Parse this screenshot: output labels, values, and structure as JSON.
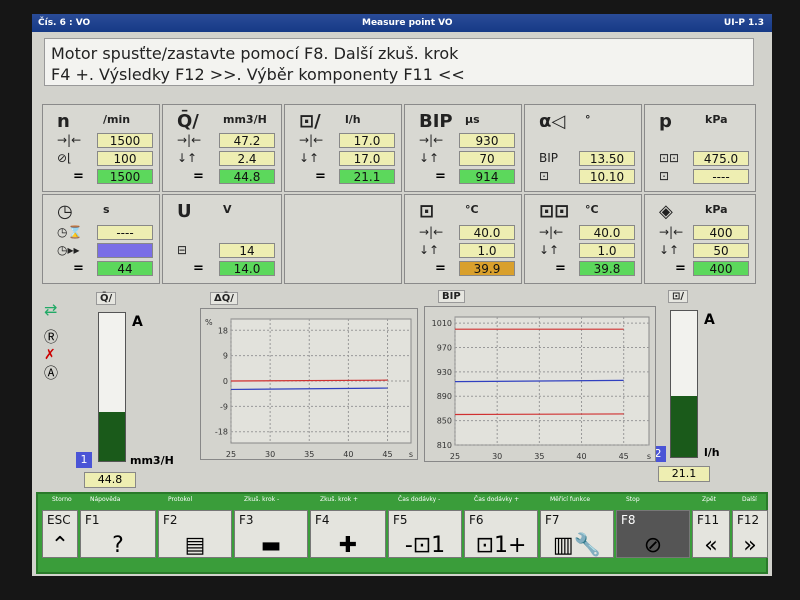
{
  "titlebar": {
    "left": "Čís. 6 : VO",
    "center": "Measure point VO",
    "right": "UI-P 1.3"
  },
  "message": {
    "line1": "Motor spusťte/zastavte pomocí F8. Další zkuš. krok",
    "line2": "F4 +. Výsledky F12 >>. Výběr komponenty F11 <<"
  },
  "panels": [
    {
      "title": "n",
      "unit": "/min",
      "rows": [
        {
          "icon": "→|←",
          "value": "1500",
          "color": "yellow"
        },
        {
          "icon": "⊘⌊",
          "value": "100",
          "color": "yellow"
        },
        {
          "icon": "=",
          "value": "1500",
          "color": "green"
        }
      ]
    },
    {
      "title": "Q̄/",
      "unit": "mm3/H",
      "rows": [
        {
          "icon": "→|←",
          "value": "47.2",
          "color": "yellow"
        },
        {
          "icon": "↓↑",
          "value": "2.4",
          "color": "yellow"
        },
        {
          "icon": "=",
          "value": "44.8",
          "color": "green"
        }
      ]
    },
    {
      "title": "⊡/",
      "unit": "l/h",
      "rows": [
        {
          "icon": "→|←",
          "value": "17.0",
          "color": "yellow"
        },
        {
          "icon": "↓↑",
          "value": "17.0",
          "color": "yellow"
        },
        {
          "icon": "=",
          "value": "21.1",
          "color": "green"
        }
      ]
    },
    {
      "title": "BIP",
      "unit": "µs",
      "rows": [
        {
          "icon": "→|←",
          "value": "930",
          "color": "yellow"
        },
        {
          "icon": "↓↑",
          "value": "70",
          "color": "yellow"
        },
        {
          "icon": "=",
          "value": "914",
          "color": "green"
        }
      ]
    },
    {
      "title": "α◁",
      "unit": "°",
      "rows": [
        {
          "icon": "BIP",
          "value": "13.50",
          "color": "yellow"
        },
        {
          "icon": "⊡",
          "value": "10.10",
          "color": "yellow"
        }
      ]
    },
    {
      "title": "p",
      "unit": "kPa",
      "rows": [
        {
          "icon": "⊡⊡",
          "value": "475.0",
          "color": "yellow"
        },
        {
          "icon": "⊡",
          "value": "----",
          "color": "yellow"
        }
      ]
    },
    {
      "title": "◷",
      "unit": "s",
      "rows": [
        {
          "icon": "◷⌛",
          "value": "----",
          "color": "yellow"
        },
        {
          "icon": "◷▸▸",
          "value": "",
          "color": "blue"
        },
        {
          "icon": "=",
          "value": "44",
          "color": "green"
        }
      ]
    },
    {
      "title": "U",
      "unit": "V",
      "rows": [
        {
          "icon": "⊟",
          "value": "14",
          "color": "yellow"
        },
        {
          "icon": "=",
          "value": "14.0",
          "color": "green"
        }
      ]
    },
    {
      "title": "",
      "unit": "",
      "rows": []
    },
    {
      "title": "⊡",
      "unit": "°C",
      "rows": [
        {
          "icon": "→|←",
          "value": "40.0",
          "color": "yellow"
        },
        {
          "icon": "↓↑",
          "value": "1.0",
          "color": "yellow"
        },
        {
          "icon": "=",
          "value": "39.9",
          "color": "orange"
        }
      ]
    },
    {
      "title": "⊡⊡",
      "unit": "°C",
      "rows": [
        {
          "icon": "→|←",
          "value": "40.0",
          "color": "yellow"
        },
        {
          "icon": "↓↑",
          "value": "1.0",
          "color": "yellow"
        },
        {
          "icon": "=",
          "value": "39.8",
          "color": "green"
        }
      ]
    },
    {
      "title": "◈",
      "unit": "kPa",
      "rows": [
        {
          "icon": "→|←",
          "value": "400",
          "color": "yellow"
        },
        {
          "icon": "↓↑",
          "value": "50",
          "color": "yellow"
        },
        {
          "icon": "=",
          "value": "400",
          "color": "green"
        }
      ]
    }
  ],
  "left_bar": {
    "label": "Q̄/",
    "letter": "A",
    "unit": "mm3/H",
    "badge": "1",
    "value": "44.8",
    "fill": 0.33
  },
  "right_bar": {
    "label": "⊡/",
    "letter": "A",
    "unit": "l/h",
    "badge": "2",
    "value": "21.1",
    "fill": 0.42
  },
  "chart_data": [
    {
      "type": "line",
      "title": "ΔQ̄/",
      "ylabel": "%",
      "x_ticks": [
        "25",
        "30",
        "35",
        "40",
        "45",
        "s"
      ],
      "y_ticks": [
        "18",
        "9",
        "0",
        "-9",
        "-18"
      ],
      "xlim": [
        25,
        48
      ],
      "ylim": [
        -22,
        22
      ],
      "series": [
        {
          "color": "#d03030",
          "x": [
            25,
            45
          ],
          "y": [
            0,
            0.3
          ]
        },
        {
          "color": "#3040c0",
          "x": [
            25,
            45
          ],
          "y": [
            -3,
            -2.5
          ]
        }
      ]
    },
    {
      "type": "line",
      "title": "BIP",
      "ylabel": "",
      "x_ticks": [
        "25",
        "30",
        "35",
        "40",
        "45",
        "s"
      ],
      "y_ticks": [
        "1010",
        "970",
        "930",
        "890",
        "850",
        "810"
      ],
      "xlim": [
        25,
        48
      ],
      "ylim": [
        810,
        1020
      ],
      "series": [
        {
          "color": "#d03030",
          "x": [
            25,
            45
          ],
          "y": [
            1000,
            1000
          ]
        },
        {
          "color": "#3040c0",
          "x": [
            25,
            45
          ],
          "y": [
            914,
            916
          ]
        },
        {
          "color": "#d03030",
          "x": [
            25,
            45
          ],
          "y": [
            860,
            861
          ]
        }
      ]
    }
  ],
  "fkeys": {
    "top_labels": [
      "Storno",
      "Nápověda",
      "Protokol",
      "Zkuš. krok -",
      "Zkuš. krok +",
      "Čas dodávky -",
      "Čas dodávky +",
      "Měřicí funkce",
      "Stop",
      "Zpět",
      "Další"
    ],
    "keys": [
      {
        "label": "ESC",
        "icon": "⌃"
      },
      {
        "label": "F1",
        "icon": "?"
      },
      {
        "label": "F2",
        "icon": "▤"
      },
      {
        "label": "F3",
        "icon": "▬"
      },
      {
        "label": "F4",
        "icon": "✚"
      },
      {
        "label": "F5",
        "icon": "-⊡1"
      },
      {
        "label": "F6",
        "icon": "⊡1+"
      },
      {
        "label": "F7",
        "icon": "▥🔧"
      },
      {
        "label": "F8",
        "icon": "⊘"
      },
      {
        "label": "F11",
        "icon": "«"
      },
      {
        "label": "F12",
        "icon": "»"
      }
    ]
  },
  "sidebar_icons": [
    "connector-icon",
    "r-icon",
    "x-icon",
    "a-icon"
  ]
}
